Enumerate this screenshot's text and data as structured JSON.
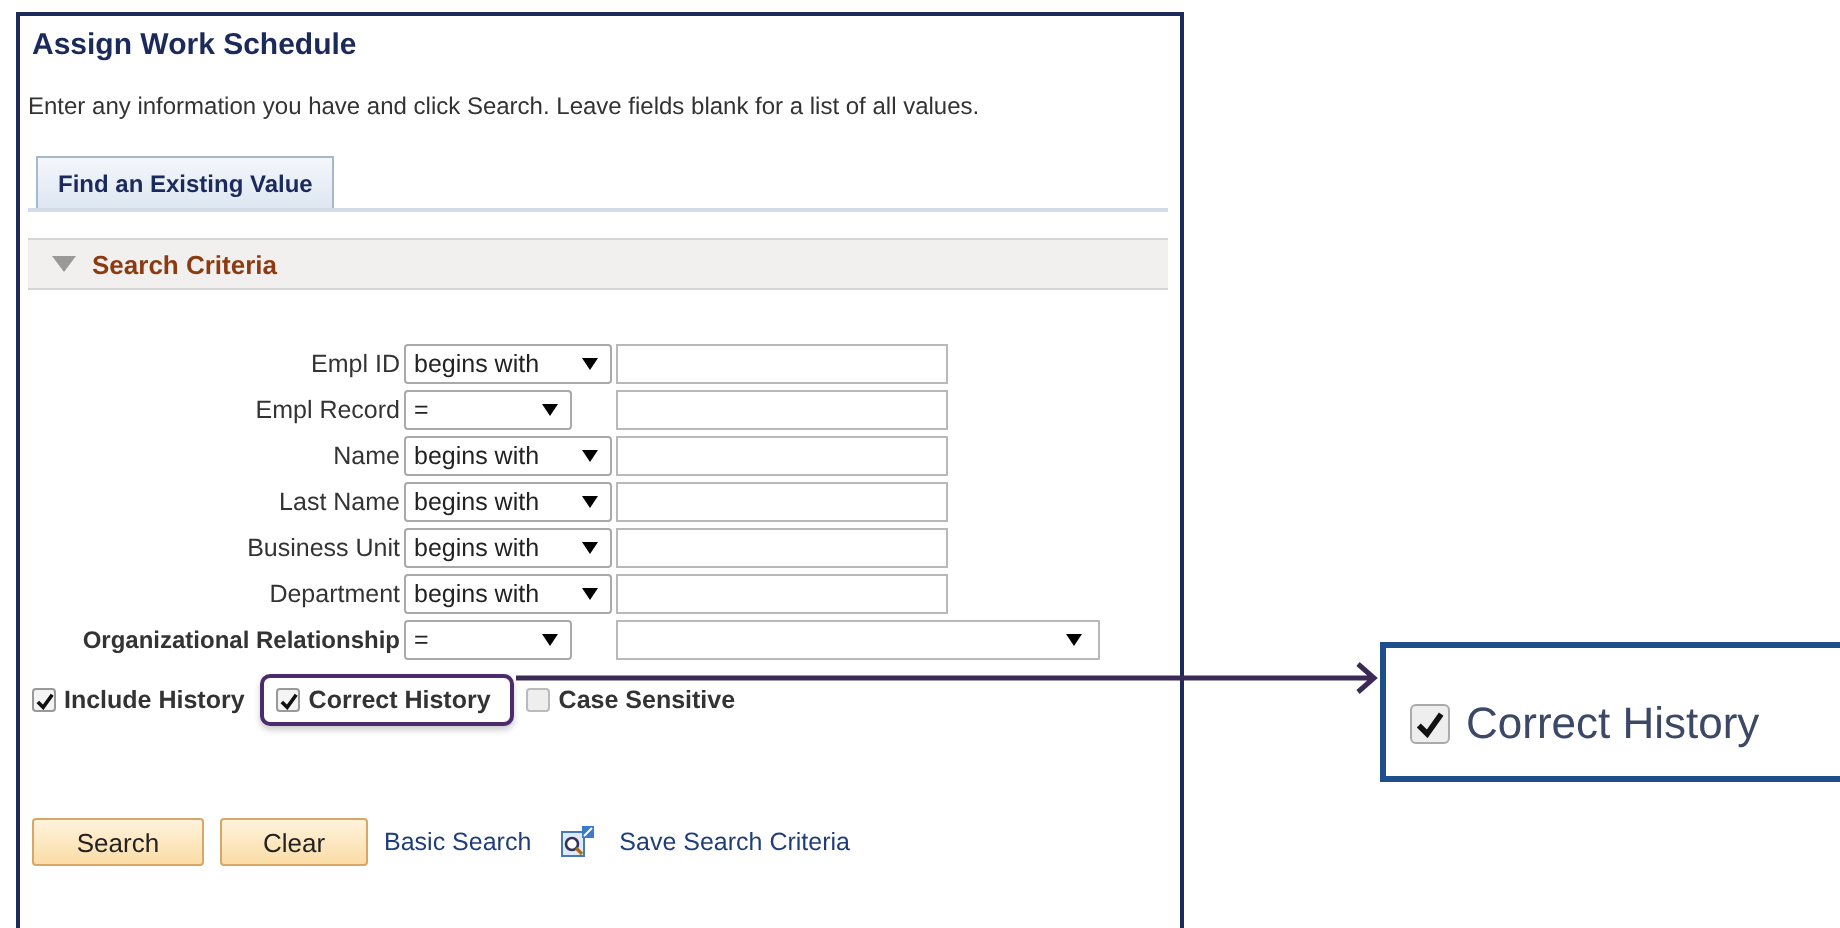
{
  "page": {
    "title": "Assign Work Schedule",
    "instructions": "Enter any information you have and click Search. Leave fields blank for a list of all values.",
    "tabs": [
      {
        "label": "Find an Existing Value",
        "selected": true
      }
    ],
    "section": {
      "title": "Search Criteria",
      "expanded": true
    },
    "fields": [
      {
        "label": "Empl ID",
        "operator": "begins with",
        "kind": "text"
      },
      {
        "label": "Empl Record",
        "operator": "=",
        "kind": "text"
      },
      {
        "label": "Name",
        "operator": "begins with",
        "kind": "text"
      },
      {
        "label": "Last Name",
        "operator": "begins with",
        "kind": "text"
      },
      {
        "label": "Business Unit",
        "operator": "begins with",
        "kind": "text"
      },
      {
        "label": "Department",
        "operator": "begins with",
        "kind": "text"
      },
      {
        "label": "Organizational Relationship",
        "operator": "=",
        "kind": "dropdown"
      }
    ],
    "options": [
      {
        "label": "Include History",
        "checked": true,
        "highlighted": false
      },
      {
        "label": "Correct History",
        "checked": true,
        "highlighted": true
      },
      {
        "label": "Case Sensitive",
        "checked": false,
        "highlighted": false
      }
    ],
    "buttons": [
      "Search",
      "Clear"
    ],
    "links": [
      "Basic Search",
      "Save Search Criteria"
    ]
  },
  "callout": {
    "label": "Correct History",
    "checked": true
  }
}
